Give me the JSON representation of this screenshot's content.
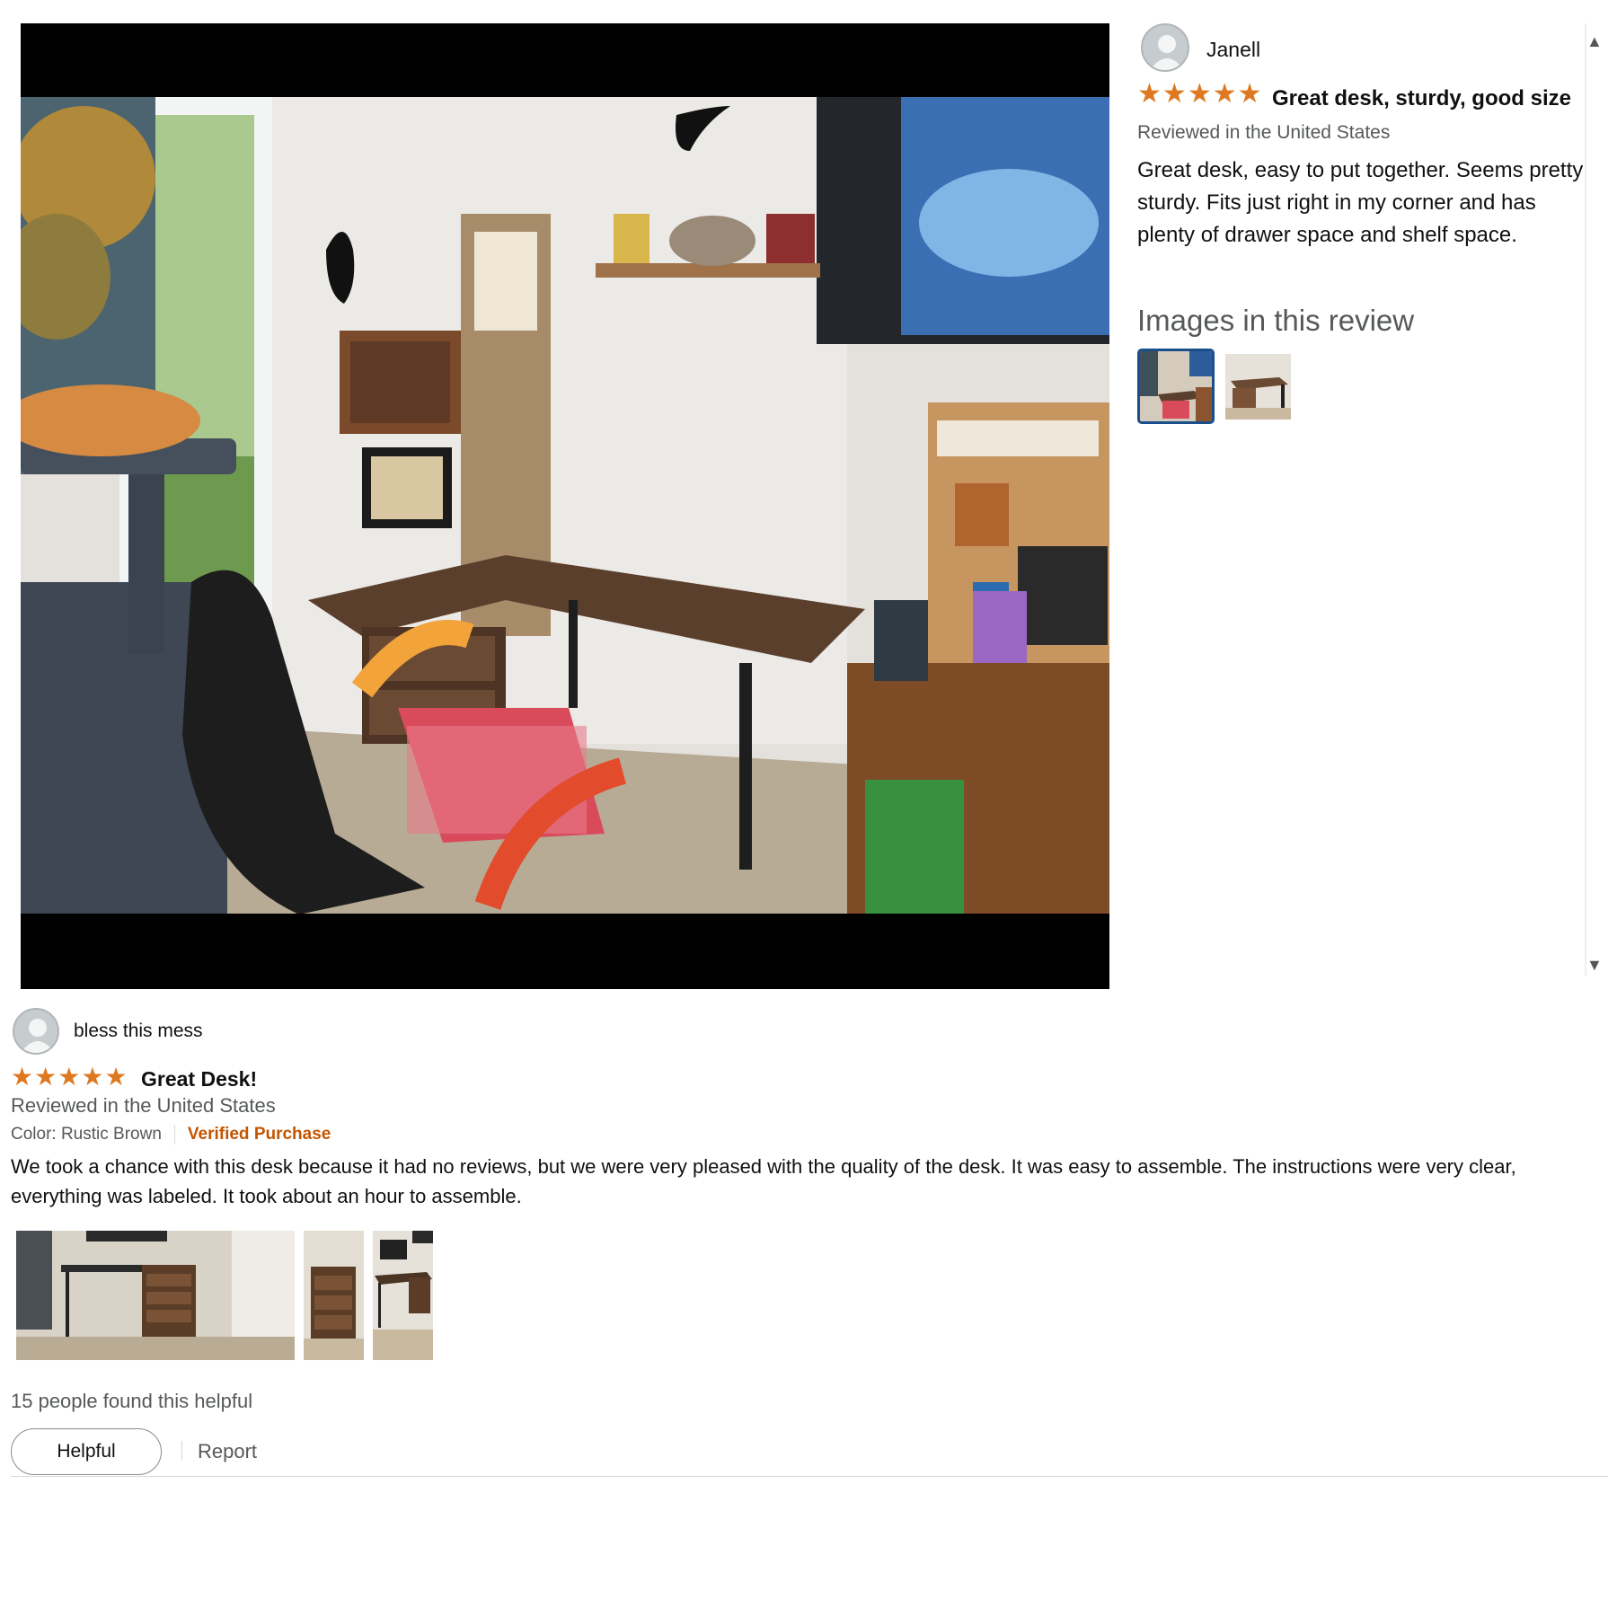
{
  "viewer": {
    "review": {
      "reviewer": "Janell",
      "rating": 5,
      "title": "Great desk, sturdy, good size",
      "location": "Reviewed in the United States",
      "body": "Great desk, easy to put together. Seems pretty sturdy. Fits just right in my corner and has plenty of drawer space and shelf space.",
      "images_heading": "Images in this review",
      "image_count": 2,
      "selected_image": 1
    }
  },
  "review2": {
    "reviewer": "bless this mess",
    "rating": 5,
    "title": "Great Desk!",
    "location": "Reviewed in the United States",
    "color": "Color: Rustic Brown",
    "verified": "Verified Purchase",
    "body": "We took a chance with this desk because it had no reviews, but we were very pleased with the quality of the desk. It was easy to assemble. The instructions were very clear, everything was labeled. It took about an hour to assemble.",
    "helpful_count": "15 people found this helpful",
    "helpful_label": "Helpful",
    "report_label": "Report",
    "image_count": 3
  },
  "icons": {
    "star": "star-icon",
    "avatar": "person-icon",
    "scroll_up": "triangle-up-icon",
    "scroll_down": "triangle-down-icon"
  },
  "colors": {
    "star": "#de7921",
    "verified": "#c45500",
    "thumb_selected_border": "#1a4f8a",
    "muted_text": "#565959"
  }
}
